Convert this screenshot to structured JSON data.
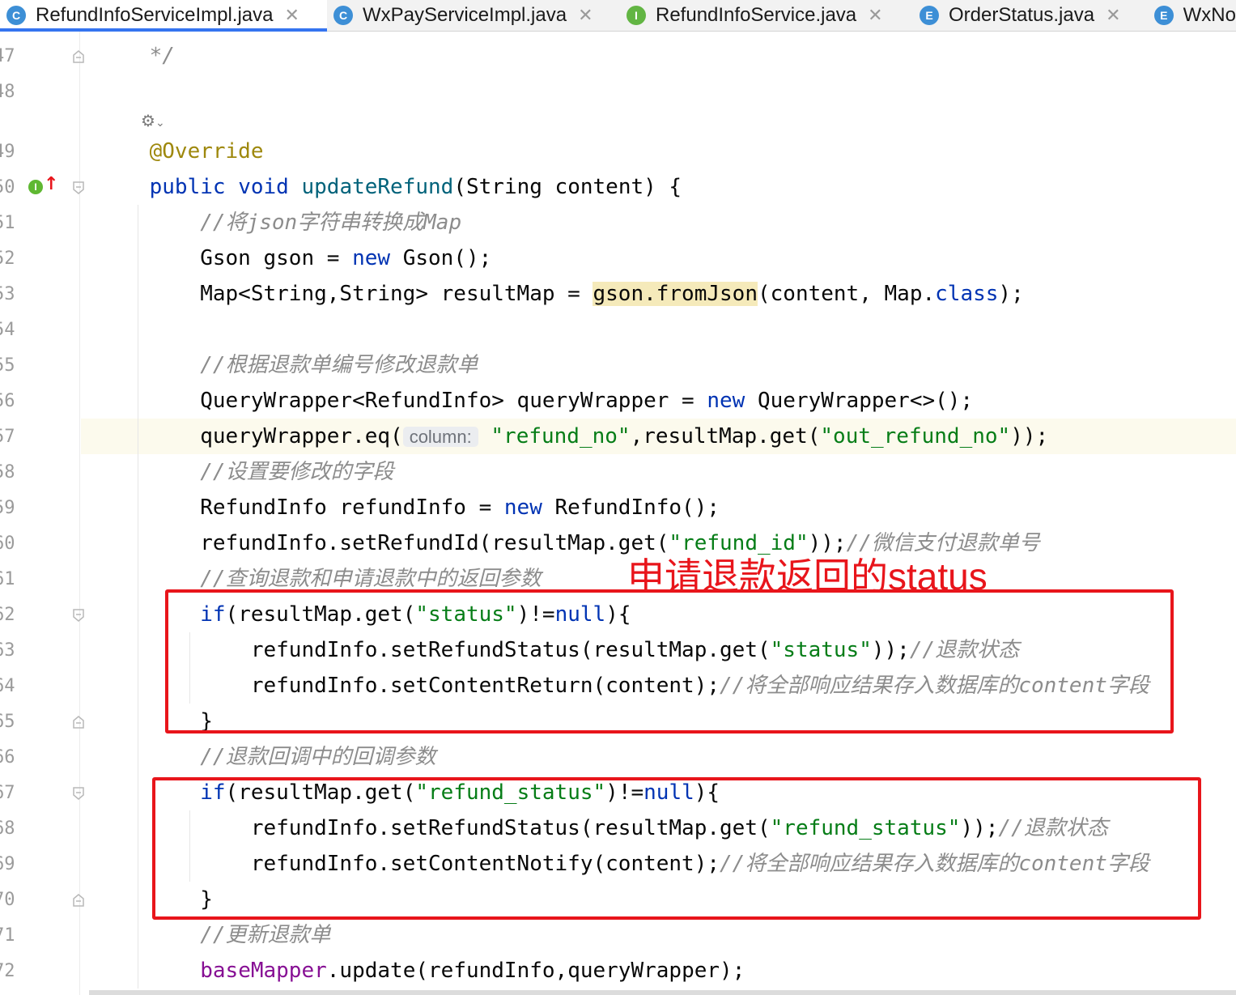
{
  "tabs": [
    {
      "label": "RefundInfoServiceImpl.java",
      "icon": "C",
      "icon_color": "#3d8fd6",
      "active": true
    },
    {
      "label": "WxPayServiceImpl.java",
      "icon": "C",
      "icon_color": "#3d8fd6",
      "active": false
    },
    {
      "label": "RefundInfoService.java",
      "icon": "I",
      "icon_color": "#62b543",
      "active": false
    },
    {
      "label": "OrderStatus.java",
      "icon": "E",
      "icon_color": "#3d8fd6",
      "active": false
    },
    {
      "label": "WxNo",
      "icon": "E",
      "icon_color": "#3d8fd6",
      "active": false
    }
  ],
  "editor": {
    "lines": [
      {
        "num": "47",
        "code": [
          {
            "t": "    */",
            "c": "cm"
          }
        ]
      },
      {
        "num": "48",
        "code": []
      },
      {
        "num": "49",
        "code": [
          {
            "t": "    @Override",
            "c": "ann"
          }
        ]
      },
      {
        "num": "50",
        "code": [
          {
            "t": "    "
          },
          {
            "t": "public",
            "c": "kw"
          },
          {
            "t": " "
          },
          {
            "t": "void",
            "c": "kw"
          },
          {
            "t": " "
          },
          {
            "t": "updateRefund",
            "c": "fn"
          },
          {
            "t": "(String content) {"
          }
        ]
      },
      {
        "num": "51",
        "code": [
          {
            "t": "        "
          },
          {
            "t": "//将json字符串转换成Map",
            "c": "cm"
          }
        ]
      },
      {
        "num": "52",
        "code": [
          {
            "t": "        Gson gson = "
          },
          {
            "t": "new",
            "c": "kw"
          },
          {
            "t": " Gson();"
          }
        ]
      },
      {
        "num": "53",
        "code": [
          {
            "t": "        Map<String,String> resultMap = "
          },
          {
            "t": "gson.fromJson",
            "c": "hlw"
          },
          {
            "t": "(content, Map."
          },
          {
            "t": "class",
            "c": "kw"
          },
          {
            "t": ");"
          }
        ]
      },
      {
        "num": "54",
        "code": []
      },
      {
        "num": "55",
        "code": [
          {
            "t": "        "
          },
          {
            "t": "//根据退款单编号修改退款单",
            "c": "cm"
          }
        ]
      },
      {
        "num": "56",
        "code": [
          {
            "t": "        QueryWrapper<RefundInfo> queryWrapper = "
          },
          {
            "t": "new",
            "c": "kw"
          },
          {
            "t": " QueryWrapper<>();"
          }
        ]
      },
      {
        "num": "57",
        "code": [
          {
            "t": "        queryWrapper.eq("
          },
          {
            "t": "column:",
            "c": "hint"
          },
          {
            "t": " "
          },
          {
            "t": "\"refund_no\"",
            "c": "str"
          },
          {
            "t": ",resultMap.get("
          },
          {
            "t": "\"out_refund_no\"",
            "c": "str"
          },
          {
            "t": "));"
          }
        ]
      },
      {
        "num": "58",
        "code": [
          {
            "t": "        "
          },
          {
            "t": "//设置要修改的字段",
            "c": "cm"
          }
        ]
      },
      {
        "num": "59",
        "code": [
          {
            "t": "        RefundInfo refundInfo = "
          },
          {
            "t": "new",
            "c": "kw"
          },
          {
            "t": " RefundInfo();"
          }
        ]
      },
      {
        "num": "60",
        "code": [
          {
            "t": "        refundInfo.setRefundId(resultMap.get("
          },
          {
            "t": "\"refund_id\"",
            "c": "str"
          },
          {
            "t": "));"
          },
          {
            "t": "//微信支付退款单号",
            "c": "cm"
          }
        ]
      },
      {
        "num": "61",
        "code": [
          {
            "t": "        "
          },
          {
            "t": "//查询退款和申请退款中的返回参数",
            "c": "cm"
          }
        ]
      },
      {
        "num": "62",
        "code": [
          {
            "t": "        "
          },
          {
            "t": "if",
            "c": "kw"
          },
          {
            "t": "(resultMap.get("
          },
          {
            "t": "\"status\"",
            "c": "str"
          },
          {
            "t": ")!="
          },
          {
            "t": "null",
            "c": "kw"
          },
          {
            "t": "){"
          }
        ]
      },
      {
        "num": "63",
        "code": [
          {
            "t": "            refundInfo.setRefundStatus(resultMap.get("
          },
          {
            "t": "\"status\"",
            "c": "str"
          },
          {
            "t": "));"
          },
          {
            "t": "//退款状态",
            "c": "cm"
          }
        ]
      },
      {
        "num": "64",
        "code": [
          {
            "t": "            refundInfo.setContentReturn(content);"
          },
          {
            "t": "//将全部响应结果存入数据库的content字段",
            "c": "cm"
          }
        ]
      },
      {
        "num": "65",
        "code": [
          {
            "t": "        }"
          }
        ]
      },
      {
        "num": "66",
        "code": [
          {
            "t": "        "
          },
          {
            "t": "//退款回调中的回调参数",
            "c": "cm"
          }
        ]
      },
      {
        "num": "67",
        "code": [
          {
            "t": "        "
          },
          {
            "t": "if",
            "c": "kw"
          },
          {
            "t": "(resultMap.get("
          },
          {
            "t": "\"refund_status\"",
            "c": "str"
          },
          {
            "t": ")!="
          },
          {
            "t": "null",
            "c": "kw"
          },
          {
            "t": "){"
          }
        ]
      },
      {
        "num": "68",
        "code": [
          {
            "t": "            refundInfo.setRefundStatus(resultMap.get("
          },
          {
            "t": "\"refund_status\"",
            "c": "str"
          },
          {
            "t": "));"
          },
          {
            "t": "//退款状态",
            "c": "cm"
          }
        ]
      },
      {
        "num": "69",
        "code": [
          {
            "t": "            refundInfo.setContentNotify(content);"
          },
          {
            "t": "//将全部响应结果存入数据库的content字段",
            "c": "cm"
          }
        ]
      },
      {
        "num": "70",
        "code": [
          {
            "t": "        }"
          }
        ]
      },
      {
        "num": "71",
        "code": [
          {
            "t": "        "
          },
          {
            "t": "//更新退款单",
            "c": "cm"
          }
        ]
      },
      {
        "num": "72",
        "code": [
          {
            "t": "        "
          },
          {
            "t": "baseMapper",
            "c": "fld"
          },
          {
            "t": ".update(refundInfo,queryWrapper);"
          }
        ]
      }
    ]
  },
  "annotation": {
    "label": "申请退款返回的status"
  }
}
